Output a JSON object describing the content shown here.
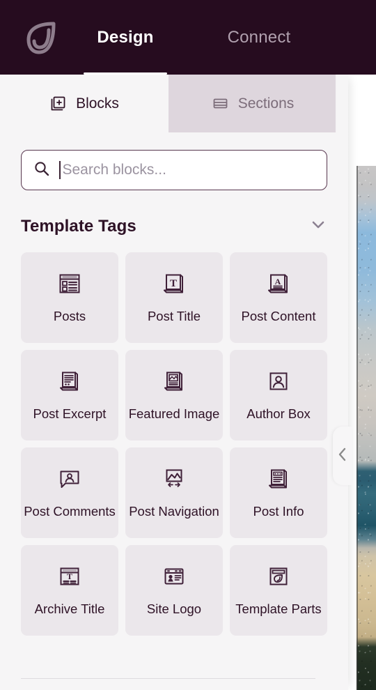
{
  "header": {
    "logo_icon": "leaf-logo-icon",
    "tabs": [
      {
        "label": "Design",
        "icon": "",
        "active": true
      },
      {
        "label": "Connect",
        "icon": "",
        "active": false
      }
    ],
    "background_color": "#260C1F",
    "active_text_color": "#FFFFFF",
    "inactive_text_color": "#B0A0AE"
  },
  "panel": {
    "tabs": [
      {
        "label": "Blocks",
        "icon": "add-block-icon",
        "active": true
      },
      {
        "label": "Sections",
        "icon": "sections-layout-icon",
        "active": false
      }
    ],
    "search": {
      "icon": "search-icon",
      "placeholder": "Search blocks...",
      "value": "",
      "focused": true
    },
    "group": {
      "title": "Template Tags",
      "chevron_icon": "chevron-down-icon",
      "expanded": true
    },
    "blocks": [
      {
        "label": "Posts",
        "icon": "posts-list-icon"
      },
      {
        "label": "Post Title",
        "icon": "post-title-icon"
      },
      {
        "label": "Post Content",
        "icon": "post-content-icon"
      },
      {
        "label": "Post Excerpt",
        "icon": "post-excerpt-icon"
      },
      {
        "label": "Featured Image",
        "icon": "featured-image-icon"
      },
      {
        "label": "Author Box",
        "icon": "author-box-icon"
      },
      {
        "label": "Post Comments",
        "icon": "post-comments-icon"
      },
      {
        "label": "Post Navigation",
        "icon": "post-navigation-icon"
      },
      {
        "label": "Post Info",
        "icon": "post-info-icon"
      },
      {
        "label": "Archive Title",
        "icon": "archive-title-icon"
      },
      {
        "label": "Site Logo",
        "icon": "site-logo-icon"
      },
      {
        "label": "Template Parts",
        "icon": "template-parts-icon"
      }
    ],
    "card_background_color": "#EBE7EB",
    "text_color": "#2E1226"
  },
  "collapse_handle": {
    "icon": "chevron-left-icon"
  },
  "preview": {
    "image_alt": "beach-photo-preview"
  }
}
